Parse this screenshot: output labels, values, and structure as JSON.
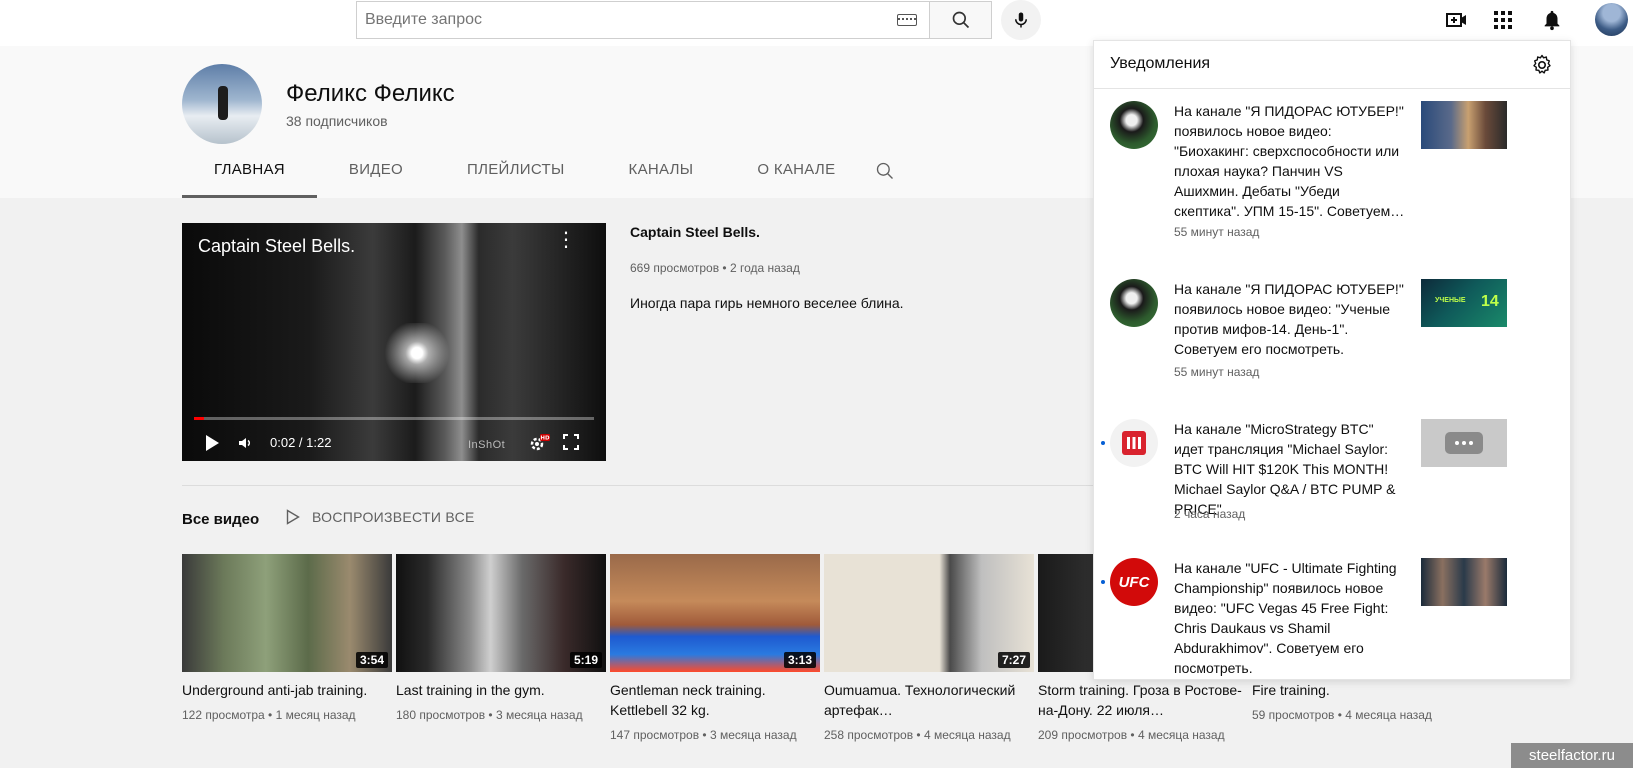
{
  "search": {
    "placeholder": "Введите запрос"
  },
  "channel": {
    "name": "Феликс Феликс",
    "subscribers": "38 подписчиков",
    "tabs": [
      "ГЛАВНАЯ",
      "ВИДЕО",
      "ПЛЕЙЛИСТЫ",
      "КАНАЛЫ",
      "О КАНАЛЕ"
    ],
    "active_tab": "ГЛАВНАЯ"
  },
  "featured": {
    "overlay_title": "Captain Steel Bells.",
    "time": "0:02 / 1:22",
    "progress": 0.025,
    "watermark": "InShOt",
    "title": "Captain Steel Bells.",
    "meta": "669 просмотров • 2 года назад",
    "description": "Иногда пара гирь немного веселее блина."
  },
  "section": {
    "title": "Все видео",
    "play_all": "ВОСПРОИЗВЕСТИ ВСЕ"
  },
  "videos": [
    {
      "title": "Underground anti-jab training.",
      "duration": "3:54",
      "meta": "122 просмотра • 1 месяц назад"
    },
    {
      "title": "Last training in the gym.",
      "duration": "5:19",
      "meta": "180 просмотров • 3 месяца назад"
    },
    {
      "title": "Gentleman neck training. Kettlebell 32 kg.",
      "duration": "3:13",
      "meta": "147 просмотров • 3 месяца назад"
    },
    {
      "title": "Oumuamua. Технологический артефак…",
      "duration": "7:27",
      "meta": "258 просмотров • 4 месяца назад"
    },
    {
      "title": "Storm training. Гроза в Ростове-на-Дону. 22 июля…",
      "duration": "",
      "meta": "209 просмотров • 4 месяца назад"
    },
    {
      "title": "Fire training.",
      "duration": "",
      "meta": "59 просмотров • 4 месяца назад"
    }
  ],
  "notifications": {
    "title": "Уведомления",
    "items": [
      {
        "text": "На канале \"Я ПИДОРАС ЮТУБЕР!\" появилось новое видео: \"Биохакинг: сверхспособности или плохая наука? Панчин VS Ашихмин. Дебаты \"Убеди скептика\". УПМ 15-15\". Советуем…",
        "time": "55 минут назад",
        "unread": false
      },
      {
        "text": "На канале \"Я ПИДОРАС ЮТУБЕР!\" появилось новое видео: \"Ученые против мифов-14. День-1\". Советуем его посмотреть.",
        "time": "55 минут назад",
        "unread": false,
        "thumb_label": "УЧЕНЫЕ",
        "thumb_number": "14"
      },
      {
        "text": "На канале \"MicroStrategy BTC\" идет трансляция \"Michael Saylor: BTC Will HIT $120K This MONTH! Michael Saylor Q&A / BTC PUMP & PRICE\"",
        "time": "2 часа назад",
        "unread": true
      },
      {
        "text": "На канале \"UFC - Ultimate Fighting Championship\" появилось новое видео: \"UFC Vegas 45 Free Fight: Chris Daukaus vs Shamil Abdurakhimov\". Советуем его посмотреть.",
        "time": "",
        "unread": true,
        "avatar_label": "UFC"
      }
    ]
  },
  "site_badge": "steelfactor.ru",
  "colors": {
    "accent_red": "#ff0000",
    "ufc_red": "#d20a0a",
    "unread_dot": "#065fd4"
  }
}
